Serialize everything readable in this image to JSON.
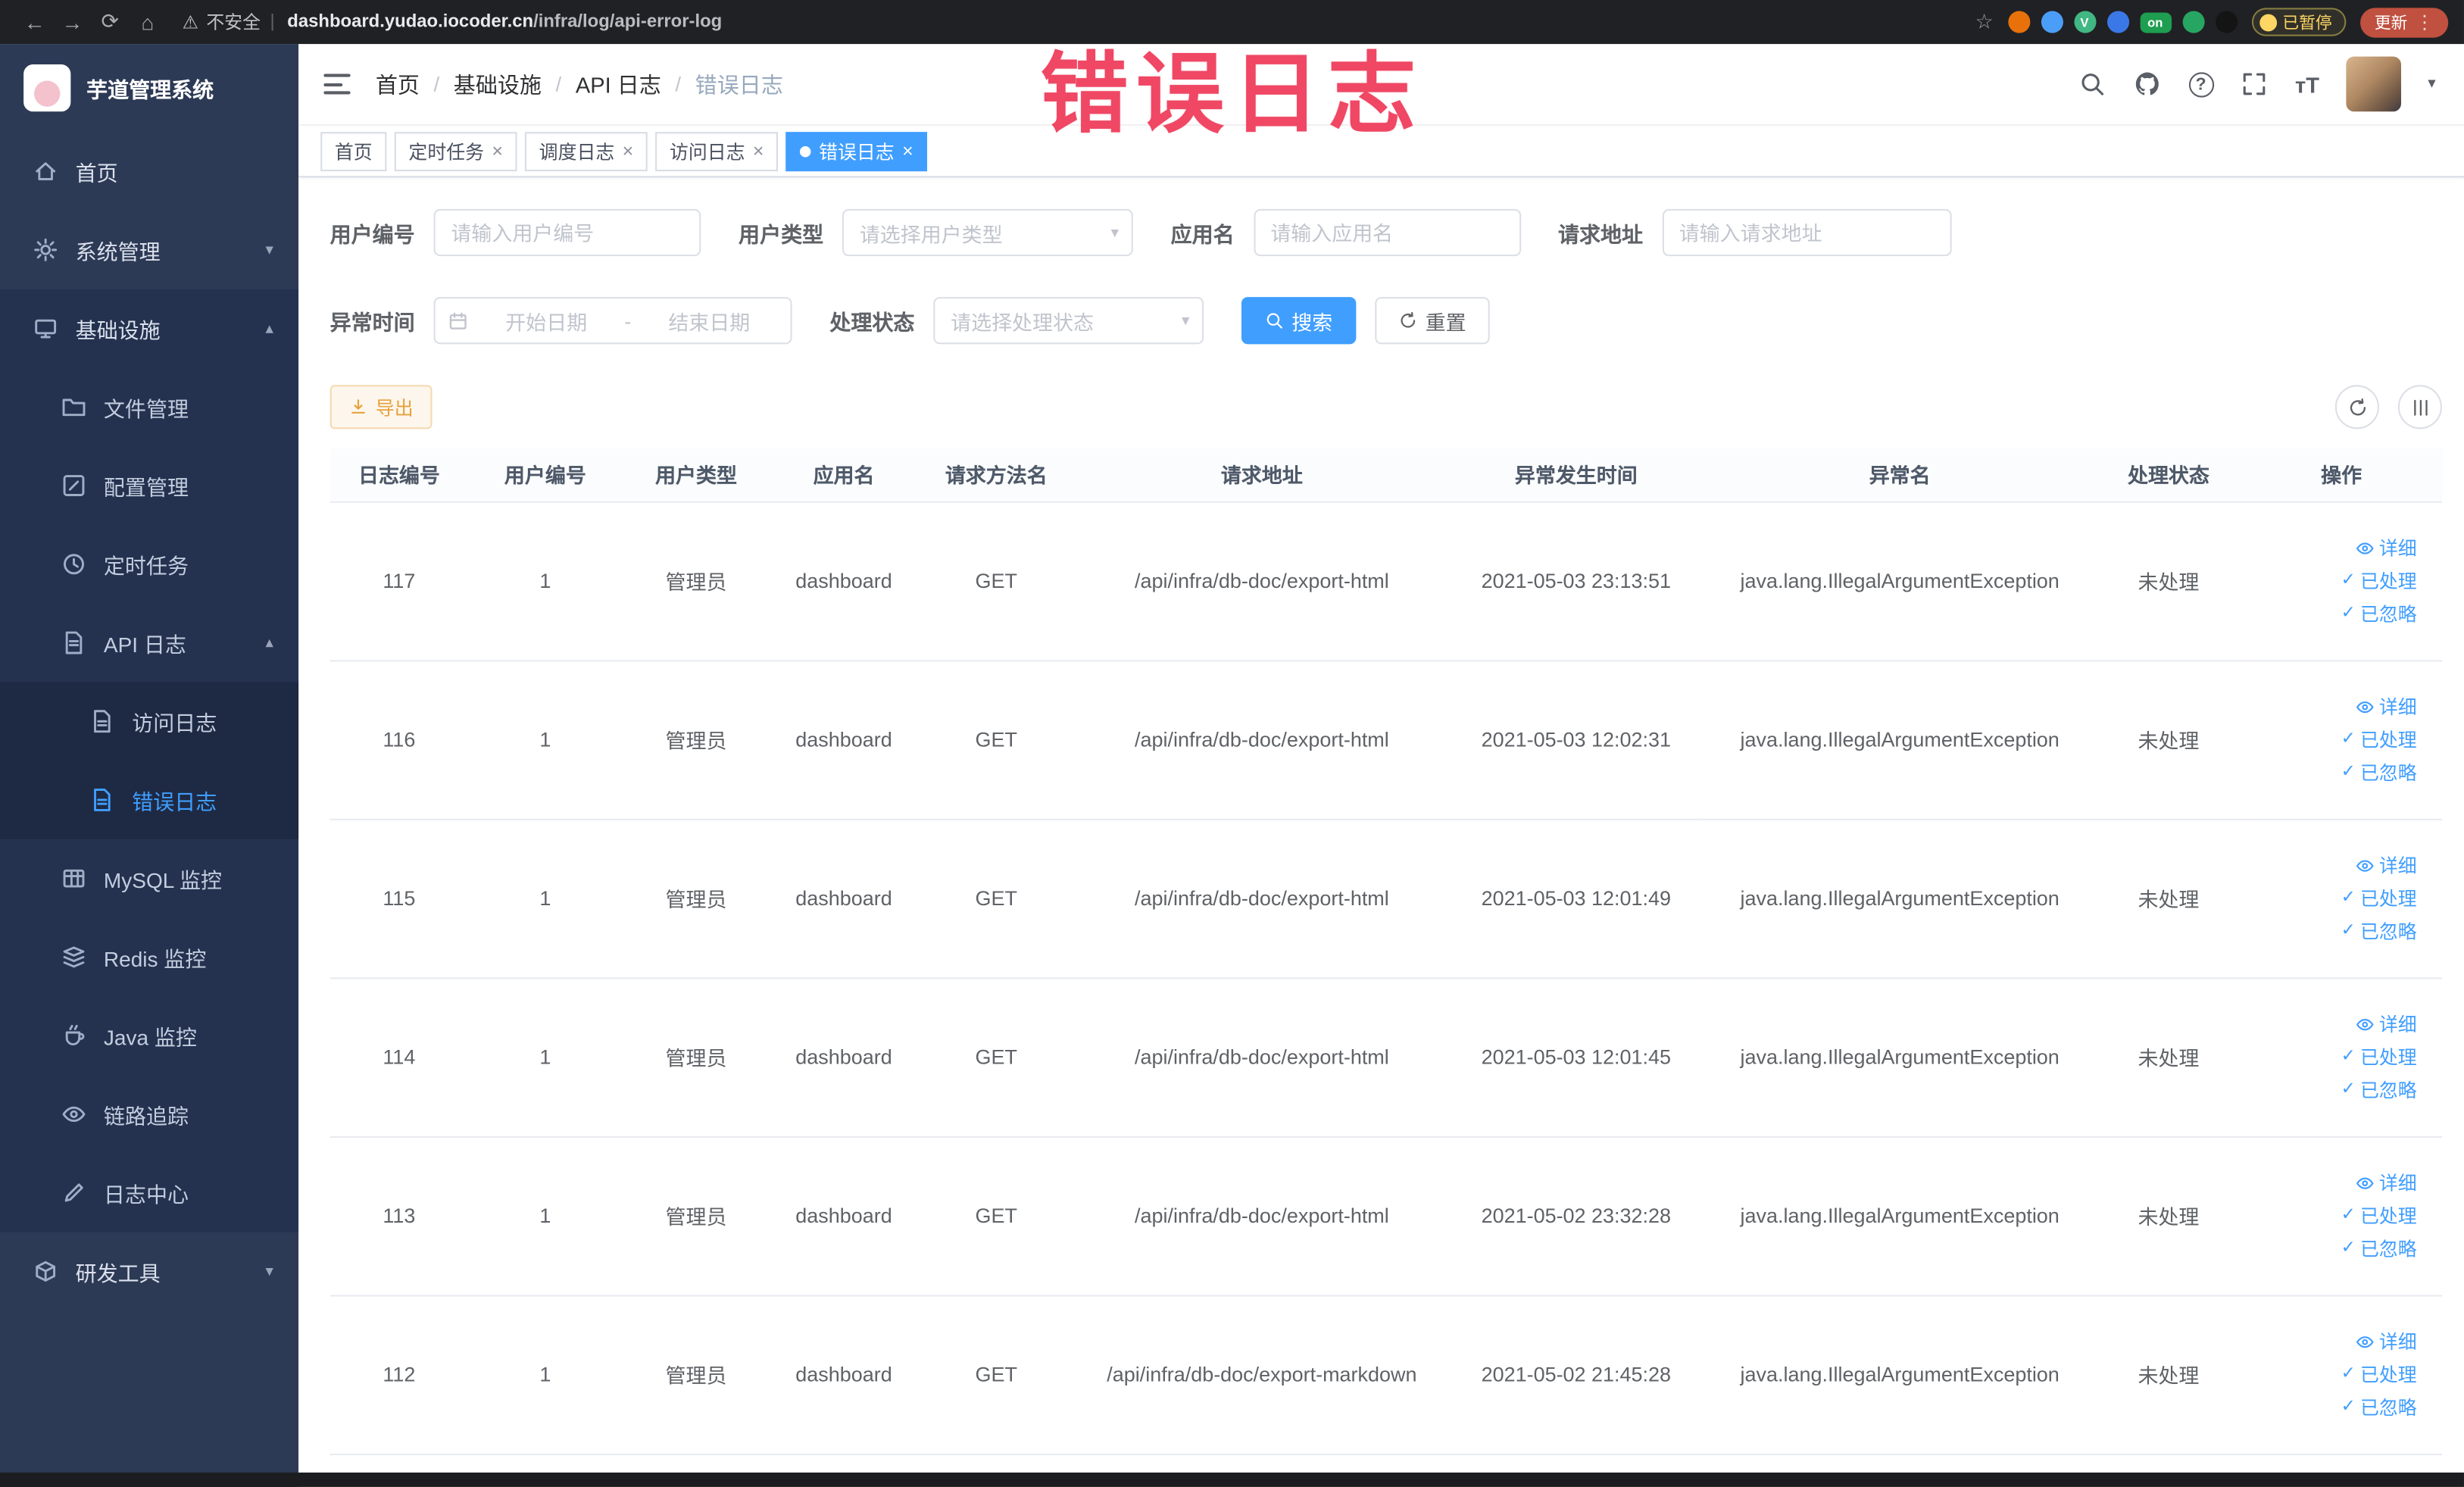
{
  "watermark": "错误日志",
  "icons": {
    "back": "←",
    "forward": "→",
    "reload": "⟳",
    "home": "⌂",
    "warning": "⚠",
    "star": "☆",
    "overflow_menu": "⋮",
    "close": "×",
    "chevron_down": "▾",
    "chevron_up": "▴",
    "caret_down": "▾",
    "question": "?",
    "text_size": "тT",
    "check": "✓",
    "active_dot": "●",
    "url_separator": "|"
  },
  "browser": {
    "security_label": "不安全",
    "url_domain": "dashboard.yudao.iocoder.cn",
    "url_path": "/infra/log/api-error-log",
    "extensions": [
      {
        "color": "#e8710a",
        "label": ""
      },
      {
        "color": "#4b9ef7",
        "label": ""
      },
      {
        "color": "#41b883",
        "label": "V"
      },
      {
        "color": "#3b78e7",
        "label": ""
      },
      {
        "color": "#1e9e50",
        "label": "on"
      },
      {
        "color": "#27a562",
        "label": ""
      },
      {
        "color": "#141414",
        "label": ""
      }
    ],
    "paused_badge": "已暂停",
    "update_button": "更新"
  },
  "sidebar": {
    "app_title": "芋道管理系统",
    "home": "首页",
    "system": "系统管理",
    "infra": "基础设施",
    "file": "文件管理",
    "config": "配置管理",
    "job": "定时任务",
    "api_log": "API 日志",
    "access_log": "访问日志",
    "error_log": "错误日志",
    "mysql": "MySQL 监控",
    "redis": "Redis 监控",
    "java": "Java 监控",
    "trace": "链路追踪",
    "log_center": "日志中心",
    "dev_tools": "研发工具"
  },
  "header": {
    "breadcrumb": [
      "首页",
      "基础设施",
      "API 日志",
      "错误日志"
    ],
    "separator": "/"
  },
  "tabs": [
    {
      "label": "首页"
    },
    {
      "label": "定时任务"
    },
    {
      "label": "调度日志"
    },
    {
      "label": "访问日志"
    },
    {
      "label": "错误日志"
    }
  ],
  "filters": {
    "user_id": {
      "label": "用户编号",
      "placeholder": "请输入用户编号"
    },
    "user_type": {
      "label": "用户类型",
      "placeholder": "请选择用户类型"
    },
    "app_name": {
      "label": "应用名",
      "placeholder": "请输入应用名"
    },
    "request_url": {
      "label": "请求地址",
      "placeholder": "请输入请求地址"
    },
    "exception_time": {
      "label": "异常时间",
      "start_placeholder": "开始日期",
      "separator": "-",
      "end_placeholder": "结束日期"
    },
    "process_status": {
      "label": "处理状态",
      "placeholder": "请选择处理状态"
    },
    "search_button": "搜索",
    "reset_button": "重置"
  },
  "toolbar": {
    "export_button": "导出"
  },
  "table": {
    "columns": [
      "日志编号",
      "用户编号",
      "用户类型",
      "应用名",
      "请求方法名",
      "请求地址",
      "异常发生时间",
      "异常名",
      "处理状态",
      "操作"
    ],
    "actions": [
      {
        "key": "detail",
        "label": "详细",
        "icon": "eye"
      },
      {
        "key": "processed",
        "label": "已处理",
        "icon": "check"
      },
      {
        "key": "ignored",
        "label": "已忽略",
        "icon": "check"
      }
    ],
    "rows": [
      {
        "id": "117",
        "user_id": "1",
        "user_type": "管理员",
        "app": "dashboard",
        "method": "GET",
        "url": "/api/infra/db-doc/export-html",
        "time": "2021-05-03 23:13:51",
        "exception": "java.lang.IllegalArgumentException",
        "status": "未处理"
      },
      {
        "id": "116",
        "user_id": "1",
        "user_type": "管理员",
        "app": "dashboard",
        "method": "GET",
        "url": "/api/infra/db-doc/export-html",
        "time": "2021-05-03 12:02:31",
        "exception": "java.lang.IllegalArgumentException",
        "status": "未处理"
      },
      {
        "id": "115",
        "user_id": "1",
        "user_type": "管理员",
        "app": "dashboard",
        "method": "GET",
        "url": "/api/infra/db-doc/export-html",
        "time": "2021-05-03 12:01:49",
        "exception": "java.lang.IllegalArgumentException",
        "status": "未处理"
      },
      {
        "id": "114",
        "user_id": "1",
        "user_type": "管理员",
        "app": "dashboard",
        "method": "GET",
        "url": "/api/infra/db-doc/export-html",
        "time": "2021-05-03 12:01:45",
        "exception": "java.lang.IllegalArgumentException",
        "status": "未处理"
      },
      {
        "id": "113",
        "user_id": "1",
        "user_type": "管理员",
        "app": "dashboard",
        "method": "GET",
        "url": "/api/infra/db-doc/export-html",
        "time": "2021-05-02 23:32:28",
        "exception": "java.lang.IllegalArgumentException",
        "status": "未处理"
      },
      {
        "id": "112",
        "user_id": "1",
        "user_type": "管理员",
        "app": "dashboard",
        "method": "GET",
        "url": "/api/infra/db-doc/export-markdown",
        "time": "2021-05-02 21:45:28",
        "exception": "java.lang.IllegalArgumentException",
        "status": "未处理"
      }
    ]
  },
  "colors": {
    "primary": "#409eff",
    "watermark": "#ef4764",
    "warning": "#e6a23c"
  }
}
